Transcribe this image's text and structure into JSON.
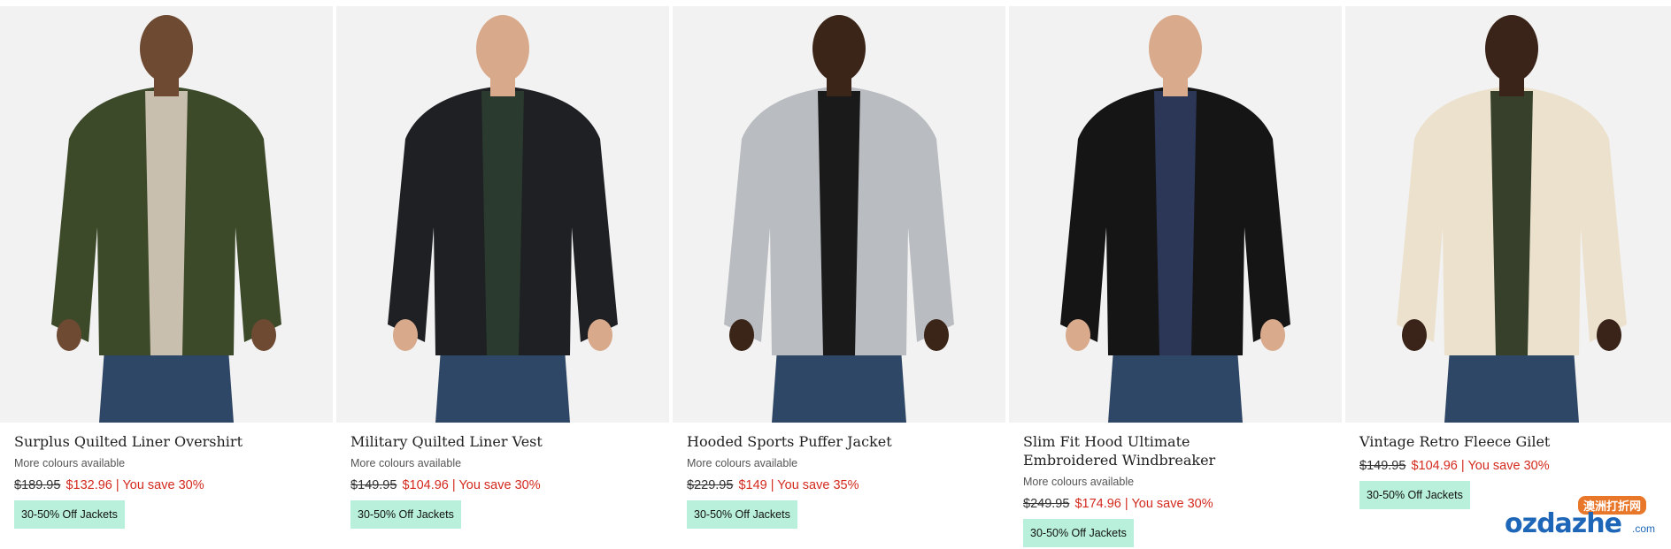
{
  "products": [
    {
      "name": "Surplus Quilted Liner Overshirt",
      "colours": "More colours available",
      "was_price": "$189.95",
      "now_price": "$132.96",
      "save": "| You save 30%",
      "badge": "30-50% Off Jackets",
      "garment_color": "#3d4a2a",
      "inner_color": "#c9bfae",
      "skin": "#6e4a33"
    },
    {
      "name": "Military Quilted Liner Vest",
      "colours": "More colours available",
      "was_price": "$149.95",
      "now_price": "$104.96",
      "save": "| You save 30%",
      "badge": "30-50% Off Jackets",
      "garment_color": "#1e2024",
      "inner_color": "#2b3a2e",
      "skin": "#d8a98a"
    },
    {
      "name": "Hooded Sports Puffer Jacket",
      "colours": "More colours available",
      "was_price": "$229.95",
      "now_price": "$149",
      "save": "| You save 35%",
      "badge": "30-50% Off Jackets",
      "garment_color": "#b9bcc0",
      "inner_color": "#1a1a1a",
      "skin": "#3b2518"
    },
    {
      "name": "Slim Fit Hood Ultimate Embroidered Windbreaker",
      "colours": "More colours available",
      "was_price": "$249.95",
      "now_price": "$174.96",
      "save": "| You save 30%",
      "badge": "30-50% Off Jackets",
      "garment_color": "#151515",
      "inner_color": "#2c3656",
      "skin": "#d9aa8c"
    },
    {
      "name": "Vintage Retro Fleece Gilet",
      "colours": "",
      "was_price": "$149.95",
      "now_price": "$104.96",
      "save": "| You save 30%",
      "badge": "30-50% Off Jackets",
      "garment_color": "#ece1cc",
      "inner_color": "#36402a",
      "skin": "#3a2419"
    }
  ],
  "watermark": {
    "cn": "澳洲打折网",
    "main": "ozdazhe",
    "com": ".com"
  }
}
